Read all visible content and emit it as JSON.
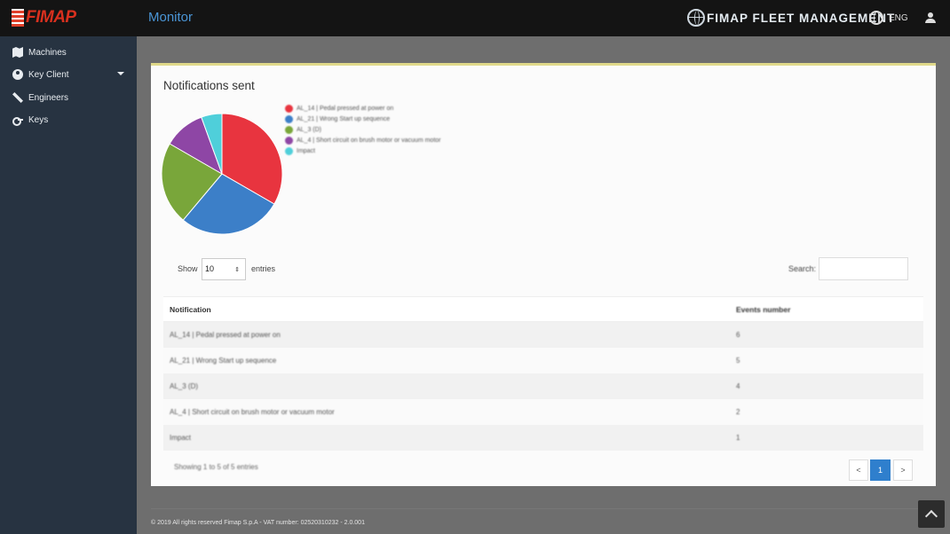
{
  "header": {
    "logo_text": "FIMAP",
    "page_title": "Monitor",
    "fleet_title": "FIMAP FLEET MANAGEMENT",
    "language": "ENG"
  },
  "sidebar": {
    "items": [
      {
        "label": "Machines",
        "icon": "map-icon"
      },
      {
        "label": "Key Client",
        "icon": "account-circle-icon"
      },
      {
        "label": "Engineers",
        "icon": "wrench-icon"
      },
      {
        "label": "Keys",
        "icon": "key-icon"
      }
    ]
  },
  "card": {
    "title": "Notifications sent"
  },
  "chart_data": {
    "type": "pie",
    "title": "",
    "slices": [
      {
        "label": "AL_14 | Pedal pressed at power on",
        "value": 6,
        "color": "#e8343f"
      },
      {
        "label": "AL_21 | Wrong Start up sequence",
        "value": 5,
        "color": "#3c7fc8"
      },
      {
        "label": "AL_3 (D)",
        "value": 4,
        "color": "#79a63a"
      },
      {
        "label": "AL_4 | Short circuit on brush motor or vacuum motor",
        "value": 2,
        "color": "#8e46a5"
      },
      {
        "label": "Impact",
        "value": 1,
        "color": "#4fcfda"
      }
    ],
    "legend_position": "right"
  },
  "table_controls": {
    "show_label": "Show",
    "entries_value": "10",
    "entries_label": "entries",
    "search_label": "Search:"
  },
  "table": {
    "headers": [
      "Notification",
      "Events number"
    ],
    "rows": [
      [
        "AL_14 | Pedal pressed at power on",
        "6"
      ],
      [
        "AL_21 | Wrong Start up sequence",
        "5"
      ],
      [
        "AL_3 (D)",
        "4"
      ],
      [
        "AL_4 | Short circuit on brush motor or vacuum motor",
        "2"
      ],
      [
        "Impact",
        "1"
      ]
    ],
    "info": "Showing 1 to 5 of 5 entries",
    "pagination": {
      "prev": "<",
      "current": "1",
      "next": ">"
    }
  },
  "footer": {
    "text": "© 2019   All rights reserved    Fimap S.p.A - VAT number: 02520310232  -  2.0.001"
  }
}
